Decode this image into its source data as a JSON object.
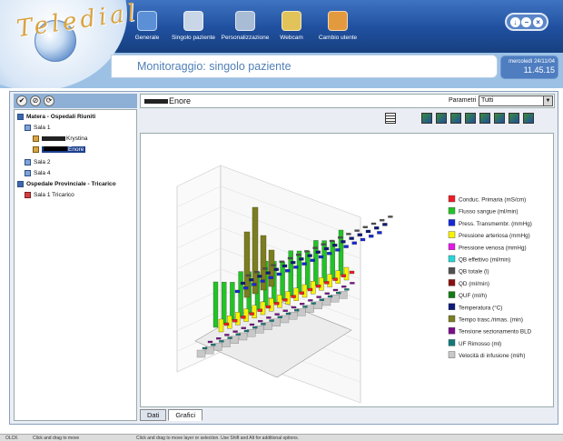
{
  "app": {
    "logo_text": "Teledial"
  },
  "nav": [
    {
      "label": "Generale",
      "color": "#5b8fd6"
    },
    {
      "label": "Singolo paziente",
      "color": "#c9d6e8"
    },
    {
      "label": "Personalizzazione",
      "color": "#a9bcd6"
    },
    {
      "label": "Webcam",
      "color": "#e2c35a"
    },
    {
      "label": "Cambio utente",
      "color": "#e39a3e"
    }
  ],
  "window_controls": [
    "↓",
    "–",
    "×"
  ],
  "page_title": "Monitoraggio: singolo paziente",
  "datetime": {
    "date": "mercoledì 24/11/04",
    "time": "11.45.15"
  },
  "tree": {
    "toolbar": [
      "✔",
      "⊘",
      "⟳"
    ],
    "items": [
      {
        "label": "Matera - Ospedali Riuniti",
        "kind": "hospital",
        "bold": true
      },
      {
        "label": "Sala 1",
        "kind": "room"
      },
      {
        "label": "Krystina",
        "kind": "patient",
        "redacted": true
      },
      {
        "label": "Enore",
        "kind": "patient",
        "redacted": true,
        "selected": true
      },
      {
        "label": "Sala 2",
        "kind": "room"
      },
      {
        "label": "Sala 4",
        "kind": "room"
      },
      {
        "label": "Ospedale Provinciale - Tricarico",
        "kind": "hospital",
        "bold": true
      },
      {
        "label": "Sala 1 Tricarico",
        "kind": "room-red"
      }
    ]
  },
  "detail": {
    "patient_name": "Enore",
    "param_label": "Parametri",
    "param_value": "Tutti"
  },
  "tabs": [
    {
      "label": "Dati",
      "active": false
    },
    {
      "label": "Grafici",
      "active": true
    }
  ],
  "legend": [
    {
      "label": "Conduc. Primaria (mS/cm)",
      "color": "#ee1c24"
    },
    {
      "label": "Flusso sangue (ml/min)",
      "color": "#22c325"
    },
    {
      "label": "Press. Transmembr. (mmHg)",
      "color": "#1528d8"
    },
    {
      "label": "Pressione arteriosa (mmHg)",
      "color": "#f7f200"
    },
    {
      "label": "Pressione venosa (mmHg)",
      "color": "#e418e6"
    },
    {
      "label": "QB effettivo (ml/min)",
      "color": "#26d6d6"
    },
    {
      "label": "QB totale (l)",
      "color": "#505050"
    },
    {
      "label": "QD (ml/min)",
      "color": "#8b1010"
    },
    {
      "label": "QUF (ml/h)",
      "color": "#127a12"
    },
    {
      "label": "Temperatura (°C)",
      "color": "#0d1a78"
    },
    {
      "label": "Tempo trasc./rimas. (min)",
      "color": "#7c7c22"
    },
    {
      "label": "Tensione sezionamento BLD",
      "color": "#7b0e8a"
    },
    {
      "label": "UF Rimosso (ml)",
      "color": "#127a7a"
    },
    {
      "label": "Velocità di infusione (ml/h)",
      "color": "#c8c8c8"
    }
  ],
  "status": {
    "left": "OLCK",
    "mid": "Click and drag to move",
    "right": "Click and drag to move layer or selection. Use Shift and Alt for additional options."
  }
}
